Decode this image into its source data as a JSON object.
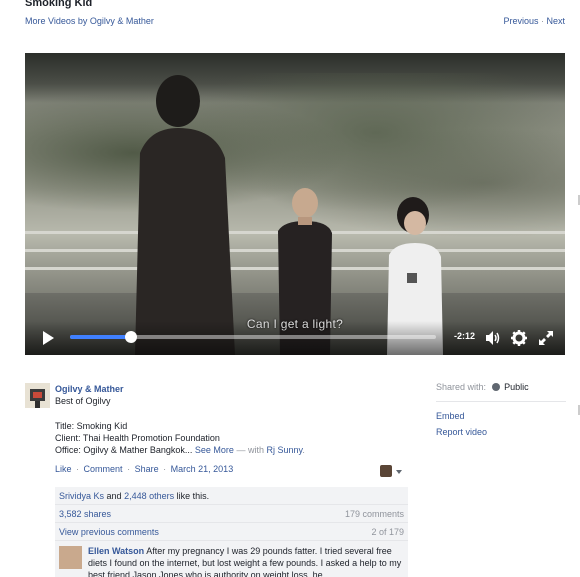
{
  "header": {
    "title": "Smoking Kid",
    "more_videos": "More Videos by Ogilvy & Mather",
    "previous": "Previous",
    "separator": "·",
    "next": "Next"
  },
  "video": {
    "subtitle": "Can I get a light?",
    "time_remaining": "-2:12",
    "progress_fraction": 0.167,
    "accent_color": "#4080ff",
    "icons": [
      "play-icon",
      "volume-icon",
      "settings-gear-icon",
      "fullscreen-icon"
    ]
  },
  "post": {
    "page_name": "Ogilvy & Mather",
    "page_subtitle": "Best of Ogilvy",
    "desc_title": "Title: Smoking Kid",
    "desc_client": "Client: Thai Health Promotion Foundation",
    "desc_office_prefix": "Office: Ogilvy & Mather Bangkok...",
    "see_more": "See More",
    "with_text": "— with",
    "tagged": "Rj Sunny",
    "period": ".",
    "actions": {
      "like": "Like",
      "comment": "Comment",
      "share": "Share",
      "date": "March 21, 2013",
      "dot": "·"
    }
  },
  "ufi": {
    "likes_name": "Srividya Ks",
    "likes_and": "and",
    "likes_others": "2,448 others",
    "likes_suffix": "like this.",
    "shares": "3,582 shares",
    "comments_count": "179 comments",
    "view_previous": "View previous comments",
    "pager": "2 of 179",
    "comment_author": "Ellen Watson",
    "comment_text": "After my pregnancy I was 29 pounds fatter. I tried several free diets I found on the internet, but lost weight a few pounds. I asked a help to my best friend Jason Jones who is authority on weight loss, he"
  },
  "sidebar": {
    "shared_with": "Shared with:",
    "audience": "Public",
    "embed": "Embed",
    "report": "Report video"
  }
}
